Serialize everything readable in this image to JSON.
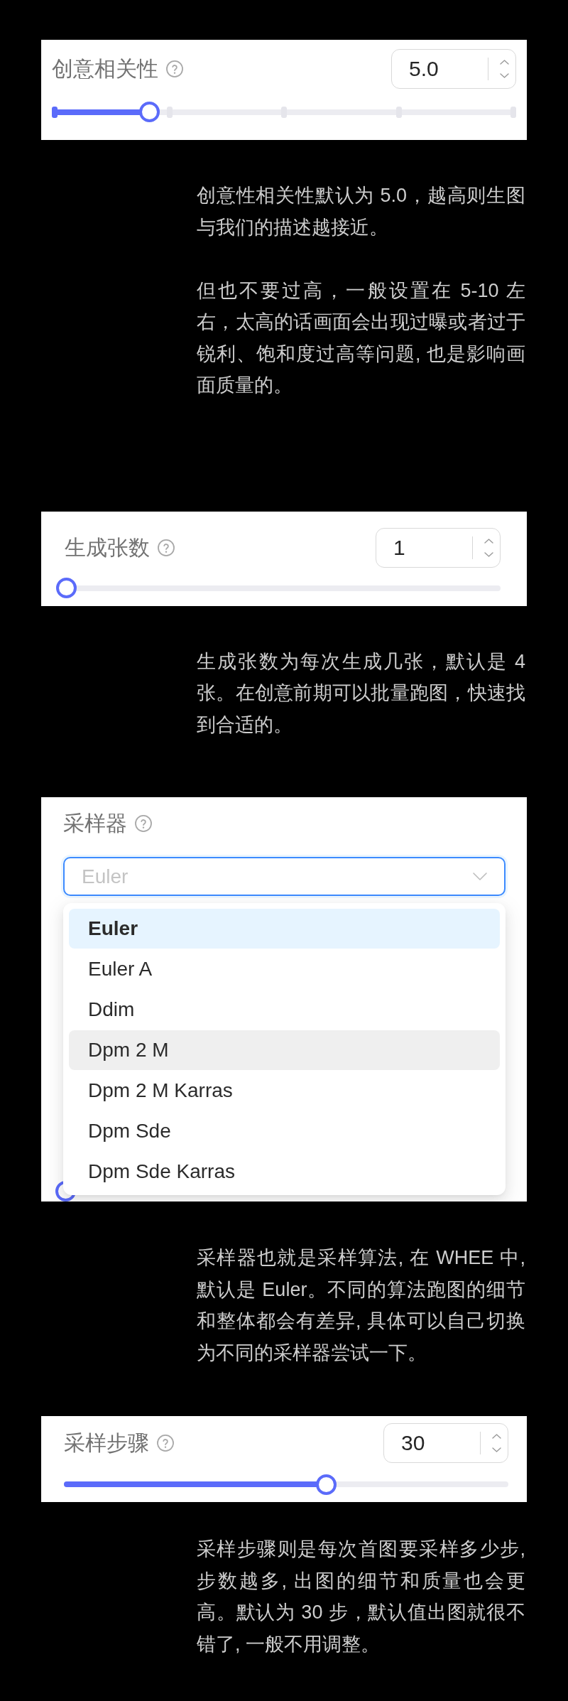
{
  "sections": [
    {
      "kind": "slider",
      "label": "创意相关性",
      "input": {
        "value": "5.0"
      },
      "slider": {
        "level": 0.21,
        "tick_marks": true
      },
      "paragraphs": [
        "创意性相关性默认为 5.0，越高则生图与我们的描述越接近。",
        "但也不要过高，一般设置在 5-10 左右，太高的话画面会出现过曝或者过于锐利、饱和度过高等问题, 也是影响画面质量的。"
      ]
    },
    {
      "kind": "slider",
      "label": "生成张数",
      "input": {
        "value": "1"
      },
      "slider": {
        "level": 0,
        "tick_marks": false
      },
      "paragraphs": [
        "生成张数为每次生成几张，默认是 4 张。在创意前期可以批量跑图，快速找到合适的。"
      ]
    },
    {
      "kind": "select",
      "label": "采样器",
      "select": {
        "value": "Euler",
        "open": true,
        "options": [
          {
            "label": "Euler",
            "selected": true,
            "hovered": false
          },
          {
            "label": "Euler A",
            "selected": false,
            "hovered": false
          },
          {
            "label": "Ddim",
            "selected": false,
            "hovered": false
          },
          {
            "label": "Dpm 2 M",
            "selected": false,
            "hovered": true
          },
          {
            "label": "Dpm 2 M Karras",
            "selected": false,
            "hovered": false
          },
          {
            "label": "Dpm Sde",
            "selected": false,
            "hovered": false
          },
          {
            "label": "Dpm Sde Karras",
            "selected": false,
            "hovered": false
          }
        ]
      },
      "covered_slider": {
        "level": 0
      },
      "paragraphs": [
        "采样器也就是采样算法, 在 WHEE 中, 默认是 Euler。不同的算法跑图的细节和整体都会有差异, 具体可以自己切换为不同的采样器尝试一下。"
      ]
    },
    {
      "kind": "slider",
      "label": "采样步骤",
      "input": {
        "value": "30"
      },
      "slider": {
        "level": 0.59,
        "tick_marks": false
      },
      "paragraphs": [
        "采样步骤则是每次首图要采样多少步, 步数越多, 出图的细节和质量也会更高。默认为 30 步，默认值出图就很不错了, 一般不用调整。"
      ]
    }
  ]
}
